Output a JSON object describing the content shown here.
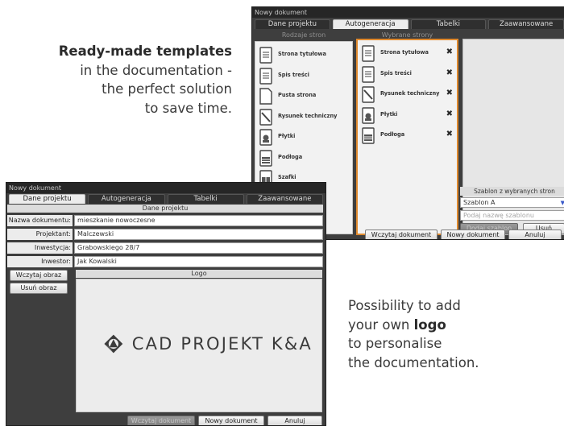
{
  "captions": {
    "top": {
      "bold": "Ready-made templates",
      "line2": "in the documentation -",
      "line3": "the perfect solution",
      "line4": "to save time."
    },
    "bottom": {
      "line1": "Possibility to add",
      "line2_pre": "your own ",
      "line2_bold": "logo",
      "line3": "to personalise",
      "line4": "the documentation."
    }
  },
  "window1": {
    "title": "Nowy dokument",
    "tabs": [
      "Dane projektu",
      "Autogeneracja",
      "Tabelki",
      "Zaawansowane"
    ],
    "active_tab": "Autogeneracja",
    "available_header": "Rodzaje stron",
    "selected_header": "Wybrane strony",
    "available_pages": [
      {
        "label": "Strona tytułowa",
        "icon": "doc-lines-icon"
      },
      {
        "label": "Spis treści",
        "icon": "doc-lines-icon"
      },
      {
        "label": "Pusta strona",
        "icon": "blank-page-icon"
      },
      {
        "label": "Rysunek techniczny",
        "icon": "drawing-icon"
      },
      {
        "label": "Płytki",
        "icon": "tile-icon"
      },
      {
        "label": "Podłoga",
        "icon": "floor-grid-icon"
      },
      {
        "label": "Szafki",
        "icon": "cabinet-icon"
      }
    ],
    "selected_pages": [
      {
        "label": "Strona tytułowa",
        "icon": "doc-lines-icon"
      },
      {
        "label": "Spis treści",
        "icon": "doc-lines-icon"
      },
      {
        "label": "Rysunek techniczny",
        "icon": "drawing-icon"
      },
      {
        "label": "Płytki",
        "icon": "tile-icon"
      },
      {
        "label": "Podłoga",
        "icon": "floor-grid-icon"
      }
    ],
    "remove_glyph": "✖",
    "template_section": "Szablon z wybranych stron",
    "template_select_value": "Szablon A",
    "template_name_placeholder": "Podaj nazwę szablonu",
    "add_template_label": "Dodaj szablon",
    "delete_label": "Usuń",
    "buttons": {
      "load": "Wczytaj dokument",
      "new": "Nowy dokument",
      "cancel": "Anuluj"
    }
  },
  "window2": {
    "title": "Nowy dokument",
    "tabs": [
      "Dane projektu",
      "Autogeneracja",
      "Tabelki",
      "Zaawansowane"
    ],
    "active_tab": "Dane projektu",
    "section_title": "Dane projektu",
    "fields": [
      {
        "label": "Nazwa dokumentu:",
        "value": "mieszkanie nowoczesne"
      },
      {
        "label": "Projektant:",
        "value": "Malczewski"
      },
      {
        "label": "Inwestycja:",
        "value": "Grabowskiego 28/7"
      },
      {
        "label": "Inwestor:",
        "value": "Jak Kowalski"
      }
    ],
    "logo_section": "Logo",
    "load_image": "Wczytaj obraz",
    "remove_image": "Usuń obraz",
    "logo_text": "CAD PROJEKT K&A",
    "buttons": {
      "load": "Wczytaj dokument",
      "new": "Nowy dokument",
      "cancel": "Anuluj"
    }
  },
  "colors": {
    "accent_orange": "#e08a2e",
    "window_bg": "#3e3e3e",
    "select_arrow": "#3a59c9"
  }
}
